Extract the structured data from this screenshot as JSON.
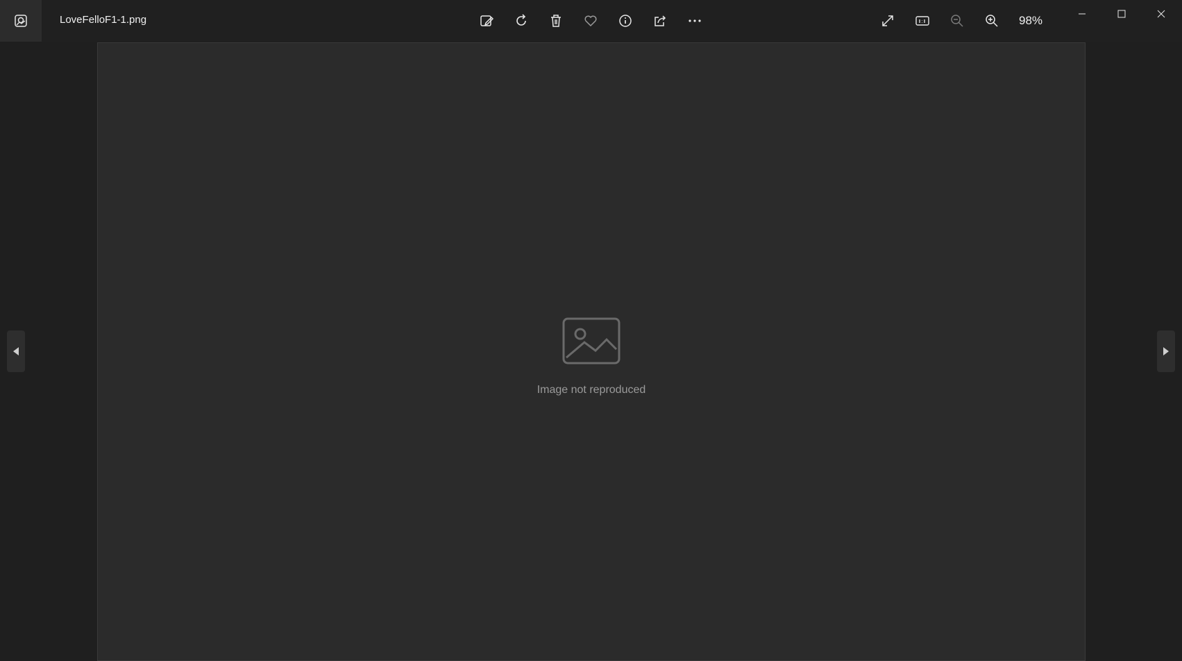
{
  "titlebar": {
    "file_name": "LoveFelloF1-1.png",
    "zoom": "98%"
  },
  "toolbar": {
    "icons": [
      "edit-icon",
      "rotate-icon",
      "delete-icon",
      "favorite-icon",
      "info-icon",
      "share-icon",
      "more-icon"
    ],
    "right_icons": [
      "fullscreen-icon",
      "actual-size-icon",
      "zoom-out-icon",
      "zoom-in-icon"
    ]
  },
  "window": {
    "controls": [
      "minimize-icon",
      "maximize-icon",
      "close-icon"
    ]
  },
  "viewer": {
    "placeholder": "Image not reproduced"
  },
  "colors": {
    "background": "#1f1f1f",
    "titlebar": "#202020",
    "accent": "#e8e8e8"
  }
}
